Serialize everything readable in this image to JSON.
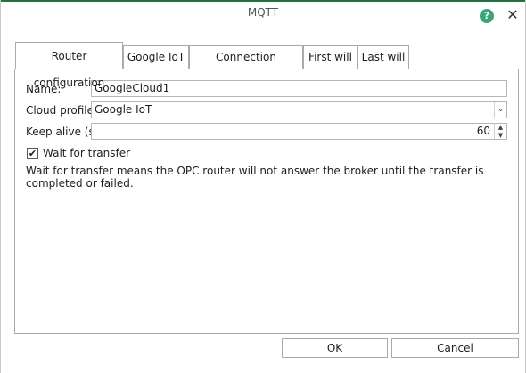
{
  "window": {
    "title": "MQTT",
    "help_symbol": "?",
    "close_symbol": "✕"
  },
  "tabs": [
    {
      "label": "Router configuration",
      "active": true
    },
    {
      "label": "Google IoT",
      "active": false
    },
    {
      "label": "Connection properties",
      "active": false
    },
    {
      "label": "First will",
      "active": false
    },
    {
      "label": "Last will",
      "active": false
    }
  ],
  "form": {
    "name_label": "Name:",
    "name_value": "GoogleCloud1",
    "cloud_profile_label": "Cloud profile:",
    "cloud_profile_value": "Google IoT",
    "keep_alive_label": "Keep alive (s):",
    "keep_alive_value": "60",
    "wait_for_transfer_label": "Wait for transfer",
    "wait_for_transfer_checked": true,
    "check_glyph": "✔",
    "hint": "Wait for transfer means the OPC router will not answer the broker until the transfer is completed or failed."
  },
  "icons": {
    "combo_arrow": "⌄",
    "spin_up": "▲",
    "spin_down": "▼"
  },
  "buttons": {
    "ok": "OK",
    "cancel": "Cancel"
  },
  "colors": {
    "accent": "#217346",
    "help": "#3aa57a"
  }
}
